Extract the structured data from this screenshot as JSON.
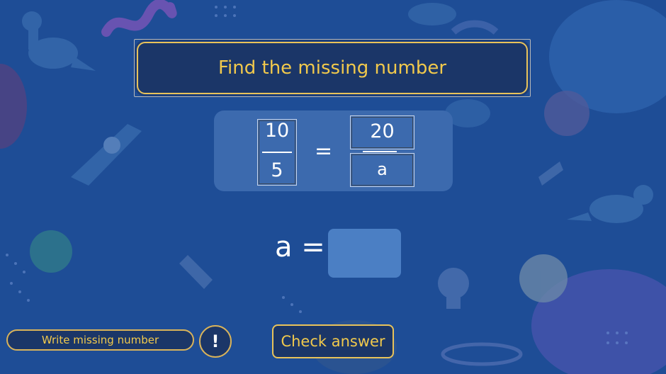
{
  "title": "Find the missing number",
  "equation": {
    "left": {
      "numerator": "10",
      "denominator": "5"
    },
    "operator": "=",
    "right": {
      "numerator": "20",
      "denominator": "a"
    }
  },
  "answer": {
    "label": "a =",
    "value": ""
  },
  "footer": {
    "hint": "Write missing number",
    "info_symbol": "!",
    "check_label": "Check answer"
  },
  "colors": {
    "background": "#1e4d96",
    "panel": "#1b3668",
    "accent_gold": "#f1c94c",
    "equation_card": "#3c6aae",
    "input": "#4b7fc4"
  },
  "decorations": [
    "dinosaur-icon",
    "rocket-icon",
    "planet-icon",
    "lightbulb-icon",
    "cloud-rainbow-icon",
    "leaf-icon",
    "pencil-icon"
  ]
}
